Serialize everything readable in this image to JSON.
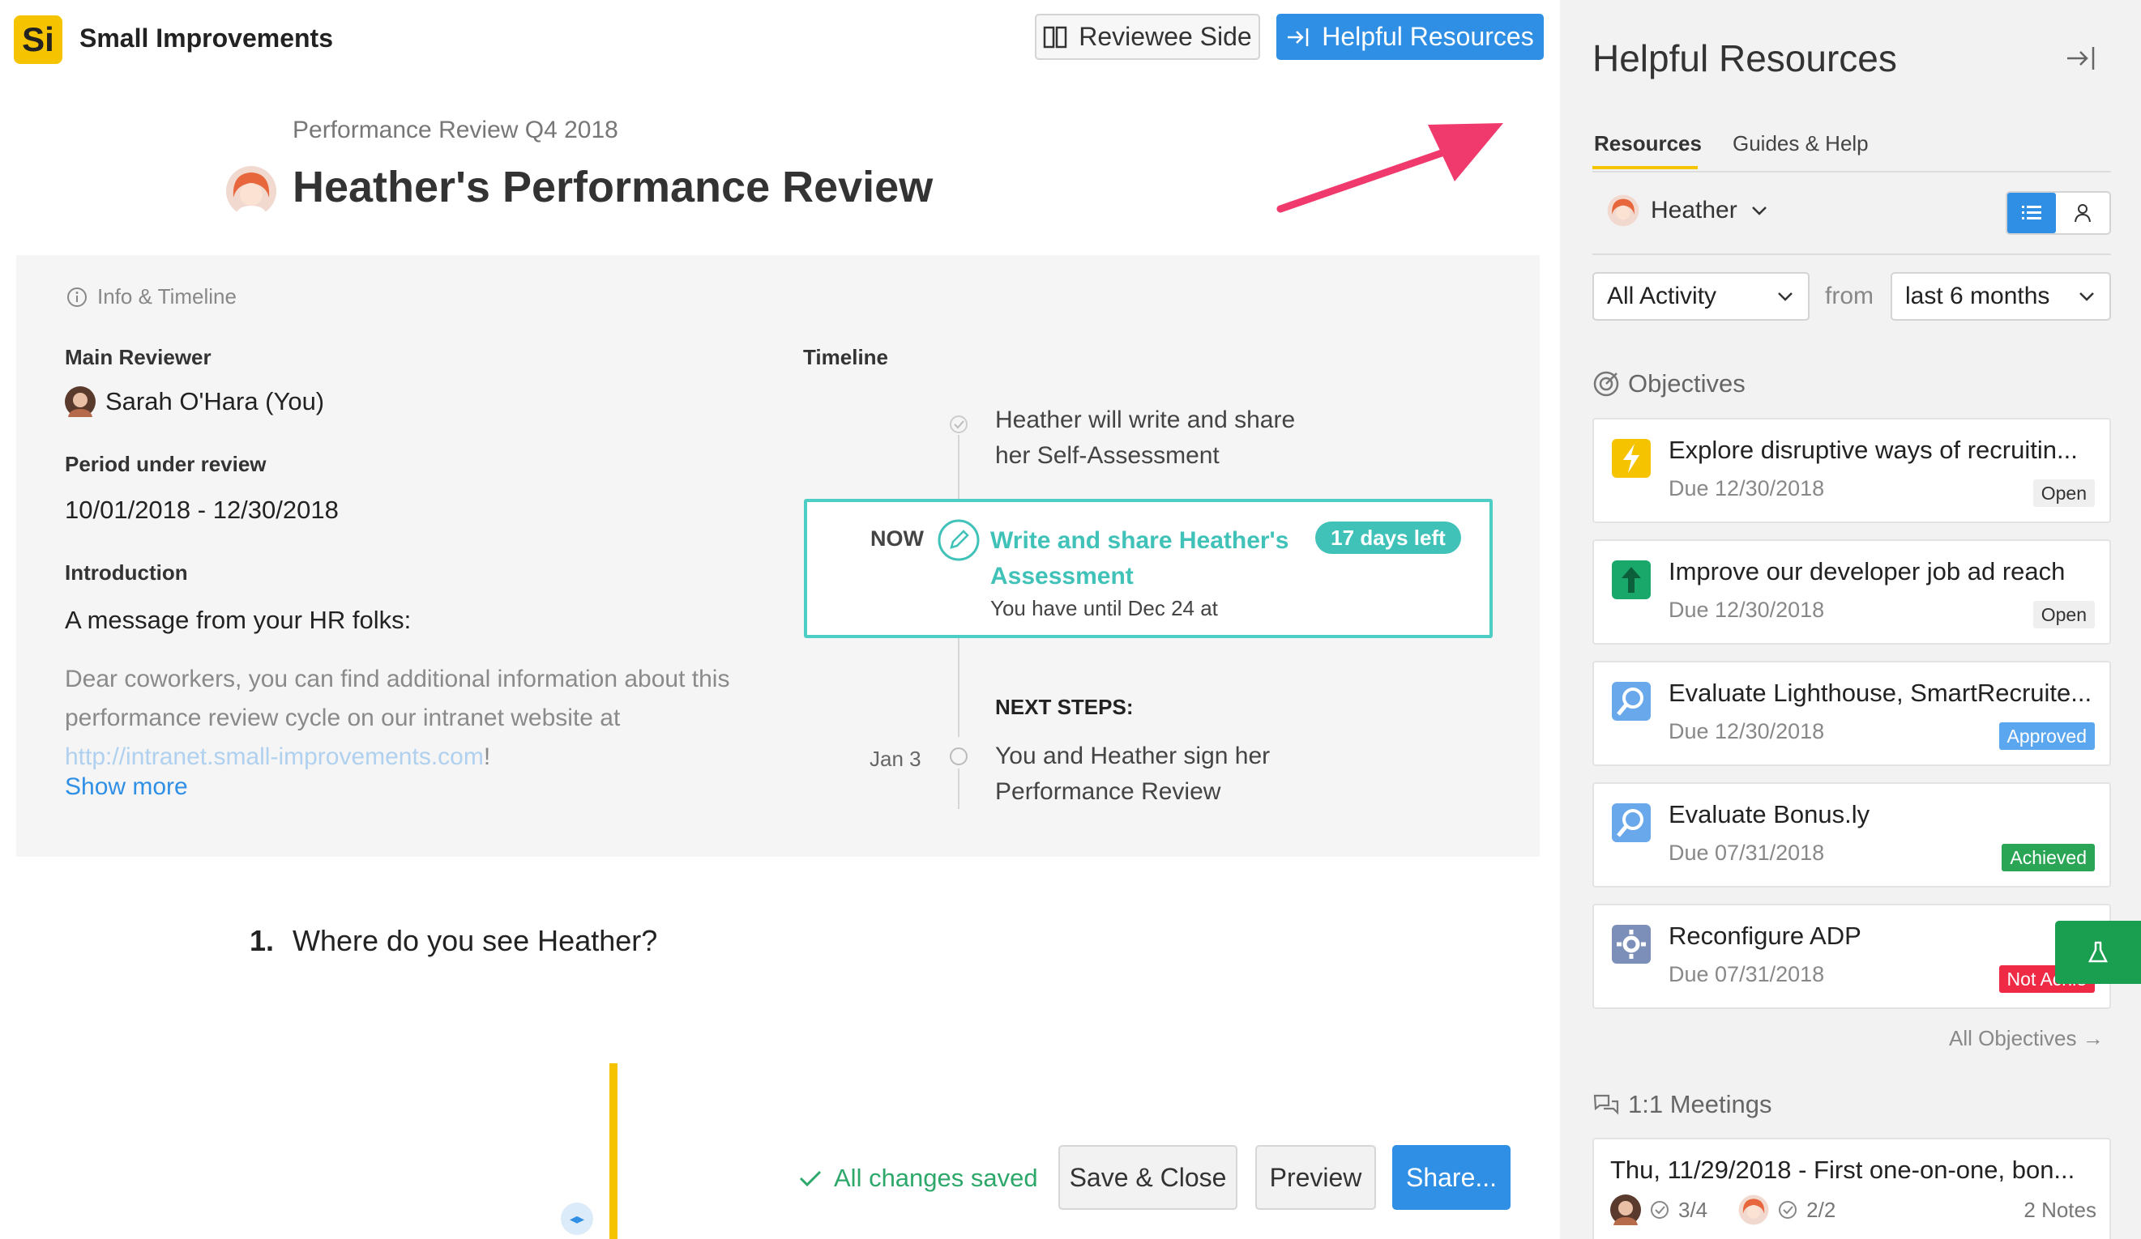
{
  "header": {
    "app_name": "Small Improvements",
    "logo_text": "Si",
    "reviewee_side_label": "Reviewee Side",
    "helpful_resources_label": "Helpful Resources"
  },
  "review": {
    "cycle_name": "Performance Review Q4 2018",
    "title": "Heather's Performance Review"
  },
  "info": {
    "section_label": "Info & Timeline",
    "main_reviewer_label": "Main Reviewer",
    "main_reviewer_value": "Sarah O'Hara (You)",
    "period_label": "Period under review",
    "period_value": "10/01/2018 - 12/30/2018",
    "intro_label": "Introduction",
    "intro_lead": "A message from your HR folks:",
    "intro_body": "Dear coworkers, you can find additional information about this performance review cycle on our intranet website at ",
    "intro_link": "http://intranet.small-improvements.com",
    "intro_tail": "!",
    "show_more": "Show more"
  },
  "timeline": {
    "label": "Timeline",
    "step1": "Heather will write and share her Self-Assessment",
    "now_label": "NOW",
    "now_title": "Write and share Heather's Assessment",
    "now_badge": "17 days left",
    "now_sub": "You have until Dec 24 at",
    "next_steps_label": "NEXT STEPS:",
    "next_date": "Jan 3",
    "next_step": "You and Heather sign her Performance Review"
  },
  "question": {
    "number": "1.",
    "text": "Where do you see Heather?"
  },
  "footer": {
    "saved_text": "All changes saved",
    "save_close_label": "Save & Close",
    "preview_label": "Preview",
    "share_label": "Share..."
  },
  "sidebar": {
    "title": "Helpful Resources",
    "tabs": [
      {
        "label": "Resources",
        "active": true
      },
      {
        "label": "Guides & Help",
        "active": false
      }
    ],
    "person": "Heather",
    "activity_filter": "All Activity",
    "from_label": "from",
    "range_filter": "last 6 months",
    "objectives_heading": "Objectives",
    "objectives": [
      {
        "title": "Explore disruptive ways of recruitin...",
        "due": "Due 12/30/2018",
        "status": "Open",
        "icon": "lightning-icon",
        "color": "#f5c300"
      },
      {
        "title": "Improve our developer job ad reach",
        "due": "Due 12/30/2018",
        "status": "Open",
        "icon": "arrow-up-icon",
        "color": "#1aa86a"
      },
      {
        "title": "Evaluate Lighthouse, SmartRecruite...",
        "due": "Due 12/30/2018",
        "status": "Approved",
        "icon": "magnifier-icon",
        "color": "#6aa8ec"
      },
      {
        "title": "Evaluate Bonus.ly",
        "due": "Due 07/31/2018",
        "status": "Achieved",
        "icon": "magnifier-icon",
        "color": "#6aa8ec"
      },
      {
        "title": "Reconfigure ADP",
        "due": "Due 07/31/2018",
        "status": "Not Achie",
        "icon": "gear-icon",
        "color": "#7b8fb8"
      }
    ],
    "all_objectives": "All Objectives →",
    "meetings_heading": "1:1 Meetings",
    "meeting": {
      "title": "Thu, 11/29/2018 - First one-on-one, bon...",
      "sarah_count": "3/4",
      "heather_count": "2/2",
      "notes": "2 Notes"
    }
  },
  "colors": {
    "brand_yellow": "#f5c300",
    "primary_blue": "#2f8fe4",
    "teal": "#40c2b8",
    "annotation_arrow": "#f0396c"
  }
}
